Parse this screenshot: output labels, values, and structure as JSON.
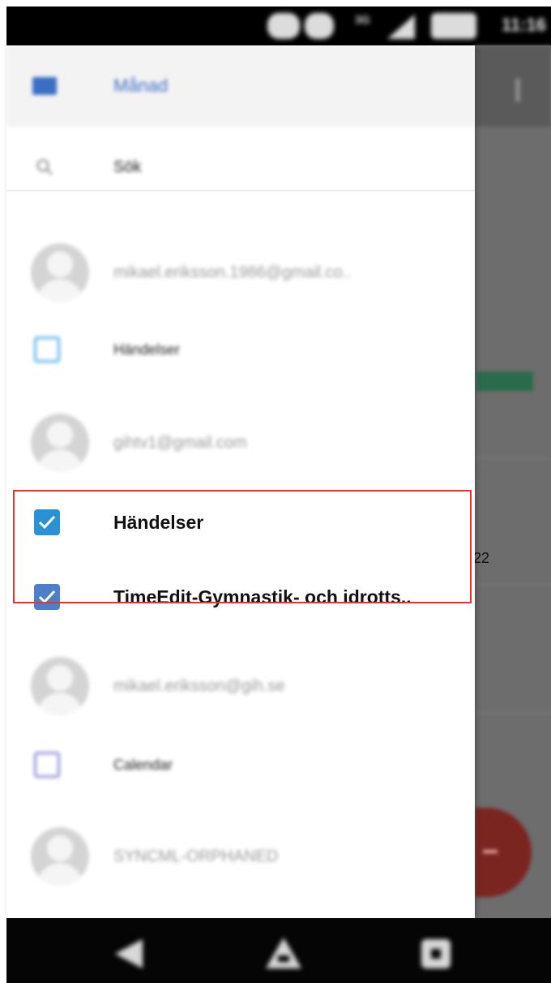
{
  "status_bar": {
    "time": "11:16",
    "network": "3G"
  },
  "drawer": {
    "month_label": "Månad",
    "search_label": "Sök",
    "accounts": [
      {
        "email": "mikael.eriksson.1986@gmail.co..",
        "calendars": [
          {
            "name": "Händelser",
            "checked": false,
            "color": "#5bb4e8"
          }
        ]
      },
      {
        "email": "gihtv1@gmail.com",
        "calendars": [
          {
            "name": "Händelser",
            "checked": true,
            "color": "#2a92d4"
          },
          {
            "name": "TimeEdit-Gymnastik- och idrotts..",
            "checked": true,
            "color": "#4d7fc6"
          }
        ]
      },
      {
        "email": "mikael.eriksson@gih.se",
        "calendars": [
          {
            "name": "Calendar",
            "checked": false,
            "color": "#8d94d6"
          }
        ]
      },
      {
        "email": "SYNCML-ORPHANED",
        "calendars": []
      }
    ]
  },
  "background_app": {
    "date_fragment": "22"
  },
  "colors": {
    "accent": "#3b6fc4",
    "highlight": "#e03535",
    "fab": "#7b2521"
  }
}
